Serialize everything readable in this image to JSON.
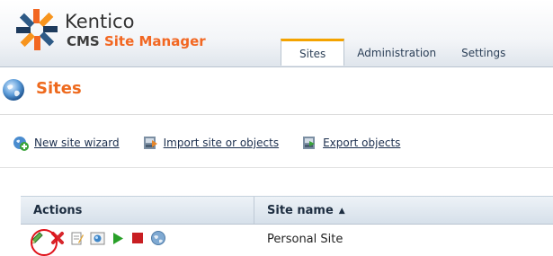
{
  "app": {
    "brand_top": "Kentico",
    "brand_prefix": "CMS",
    "brand_accent": "Site Manager",
    "logo_icon": "kentico-logo-icon"
  },
  "tabs": [
    {
      "label": "Sites",
      "active": true
    },
    {
      "label": "Administration",
      "active": false
    },
    {
      "label": "Settings",
      "active": false
    }
  ],
  "page": {
    "title": "Sites",
    "title_icon": "globe-icon",
    "title_color": "#ee6a1e"
  },
  "actions": [
    {
      "label": "New site wizard",
      "icon": "new-site-icon"
    },
    {
      "label": "Import site or objects",
      "icon": "import-icon"
    },
    {
      "label": "Export objects",
      "icon": "export-icon"
    }
  ],
  "grid": {
    "columns": [
      "Actions",
      "Site name"
    ],
    "sort_indicator": "▲",
    "rows": [
      {
        "site_name": "Personal Site",
        "action_icons": [
          "edit-icon",
          "delete-icon",
          "edit-site-icon",
          "preview-icon",
          "start-icon",
          "stop-icon",
          "open-site-icon"
        ]
      }
    ]
  },
  "highlight": {
    "target": "edit-icon",
    "color": "#e0131b"
  }
}
